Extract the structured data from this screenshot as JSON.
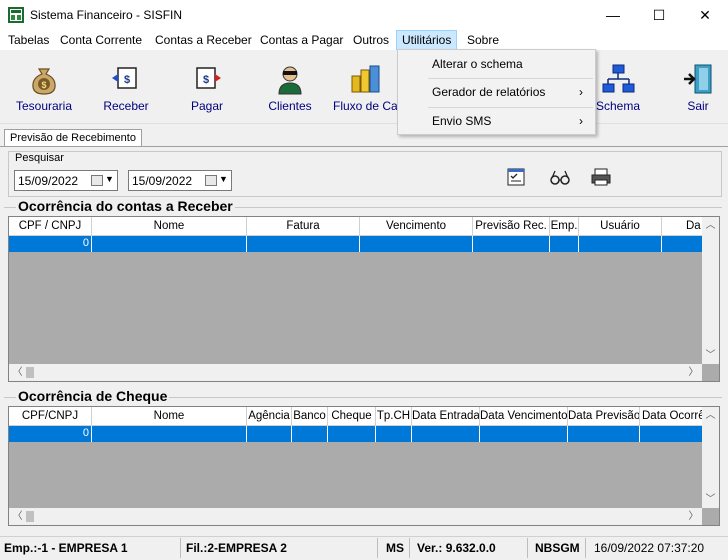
{
  "window": {
    "title": "Sistema Financeiro - SISFIN",
    "minimize": "—",
    "maximize": "☐",
    "close": "✕"
  },
  "menubar": [
    "Tabelas",
    "Conta Corrente",
    "Contas a Receber",
    "Contas a Pagar",
    "Outros",
    "Utilitários",
    "Sobre"
  ],
  "toolbar": [
    {
      "label": "Tesouraria",
      "icon": "money-bag-icon"
    },
    {
      "label": "Receber",
      "icon": "receive-money-icon"
    },
    {
      "label": "Pagar",
      "icon": "pay-money-icon"
    },
    {
      "label": "Clientes",
      "icon": "client-person-icon"
    },
    {
      "label": "Fluxo de Caixa",
      "icon": "cash-flow-icon"
    },
    {
      "label": "Schema",
      "icon": "schema-tree-icon"
    },
    {
      "label": "Sair",
      "icon": "exit-door-icon"
    }
  ],
  "dropdown": {
    "items": [
      {
        "label": "Alterar o schema",
        "submenu": false
      },
      {
        "label": "Gerador de relatórios",
        "submenu": true
      },
      {
        "label": "Envio SMS",
        "submenu": true
      }
    ],
    "chevron": "›"
  },
  "tab": {
    "label": "Previsão de Recebimento"
  },
  "search": {
    "label": "Pesquisar",
    "date_from": "15/09/2022",
    "date_to": "15/09/2022"
  },
  "receber": {
    "title": "Ocorrência do contas a Receber",
    "columns": [
      "CPF / CNPJ",
      "Nome",
      "Fatura",
      "Vencimento",
      "Previsão Rec.",
      "Emp.",
      "Usuário",
      "Da"
    ],
    "rows": [
      [
        "0",
        "",
        "",
        "",
        "",
        "",
        "",
        ""
      ]
    ]
  },
  "cheque": {
    "title": "Ocorrência de Cheque",
    "columns": [
      "CPF/CNPJ",
      "Nome",
      "Agência",
      "Banco",
      "Cheque",
      "Tp.CH",
      "Data Entrada",
      "Data Vencimento",
      "Data Previsão",
      "Data Ocorrê"
    ],
    "rows": [
      [
        "0",
        "",
        "",
        "",
        "",
        "",
        "",
        "",
        "",
        ""
      ]
    ]
  },
  "status": {
    "empresa": "Emp.:-1 - EMPRESA 1",
    "filial": "Fil.:2-EMPRESA 2",
    "uf": "MS",
    "version": "Ver.: 9.632.0.0",
    "user": "NBSGM",
    "datetime": "16/09/2022 07:37:20"
  }
}
